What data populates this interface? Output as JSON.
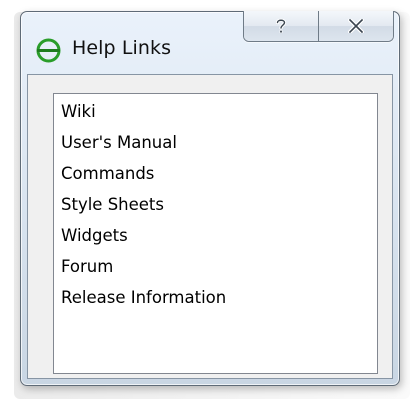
{
  "window": {
    "title": "Help Links",
    "icon": "green-circle-app-icon",
    "caption_buttons": [
      {
        "name": "help",
        "icon": "question-mark-icon"
      },
      {
        "name": "close",
        "icon": "close-x-icon"
      }
    ]
  },
  "links": [
    {
      "label": "Wiki"
    },
    {
      "label": "User's Manual"
    },
    {
      "label": "Commands"
    },
    {
      "label": "Style Sheets"
    },
    {
      "label": "Widgets"
    },
    {
      "label": "Forum"
    },
    {
      "label": "Release Information"
    }
  ],
  "colors": {
    "icon_green": "#2a9d2a",
    "titlebar_top": "#eaf2fb",
    "titlebar_bottom": "#c9d6e3"
  }
}
